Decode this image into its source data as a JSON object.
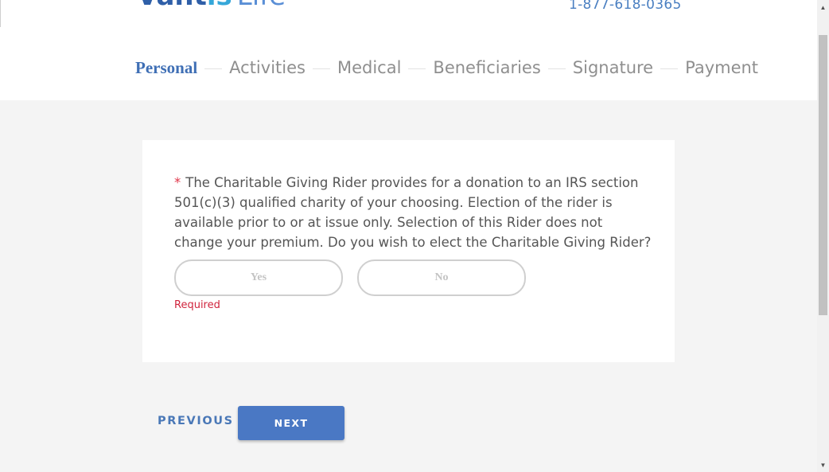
{
  "header": {
    "logo": {
      "main": "Vant",
      "accent": "is",
      "life": "Life"
    },
    "phone": "1-877-618-0365"
  },
  "steps": [
    {
      "label": "Personal",
      "active": true
    },
    {
      "label": "Activities",
      "active": false
    },
    {
      "label": "Medical",
      "active": false
    },
    {
      "label": "Beneficiaries",
      "active": false
    },
    {
      "label": "Signature",
      "active": false
    },
    {
      "label": "Payment",
      "active": false
    }
  ],
  "question": {
    "required_marker": "*",
    "text": "The Charitable Giving Rider provides for a donation to an IRS section 501(c)(3) qualified charity of your choosing. Election of the rider is available prior to or at issue only. Selection of this Rider does not change your premium. Do you wish to elect the Charitable Giving Rider?",
    "options": {
      "yes": "Yes",
      "no": "No"
    },
    "validation": "Required"
  },
  "nav": {
    "previous": "PREVIOUS",
    "next": "NEXT"
  },
  "scrollbar": {
    "up_icon": "▲",
    "down_icon": "▼"
  },
  "colors": {
    "accent": "#4a78c4",
    "active_step": "#3f6fb5",
    "error": "#d0243d"
  }
}
